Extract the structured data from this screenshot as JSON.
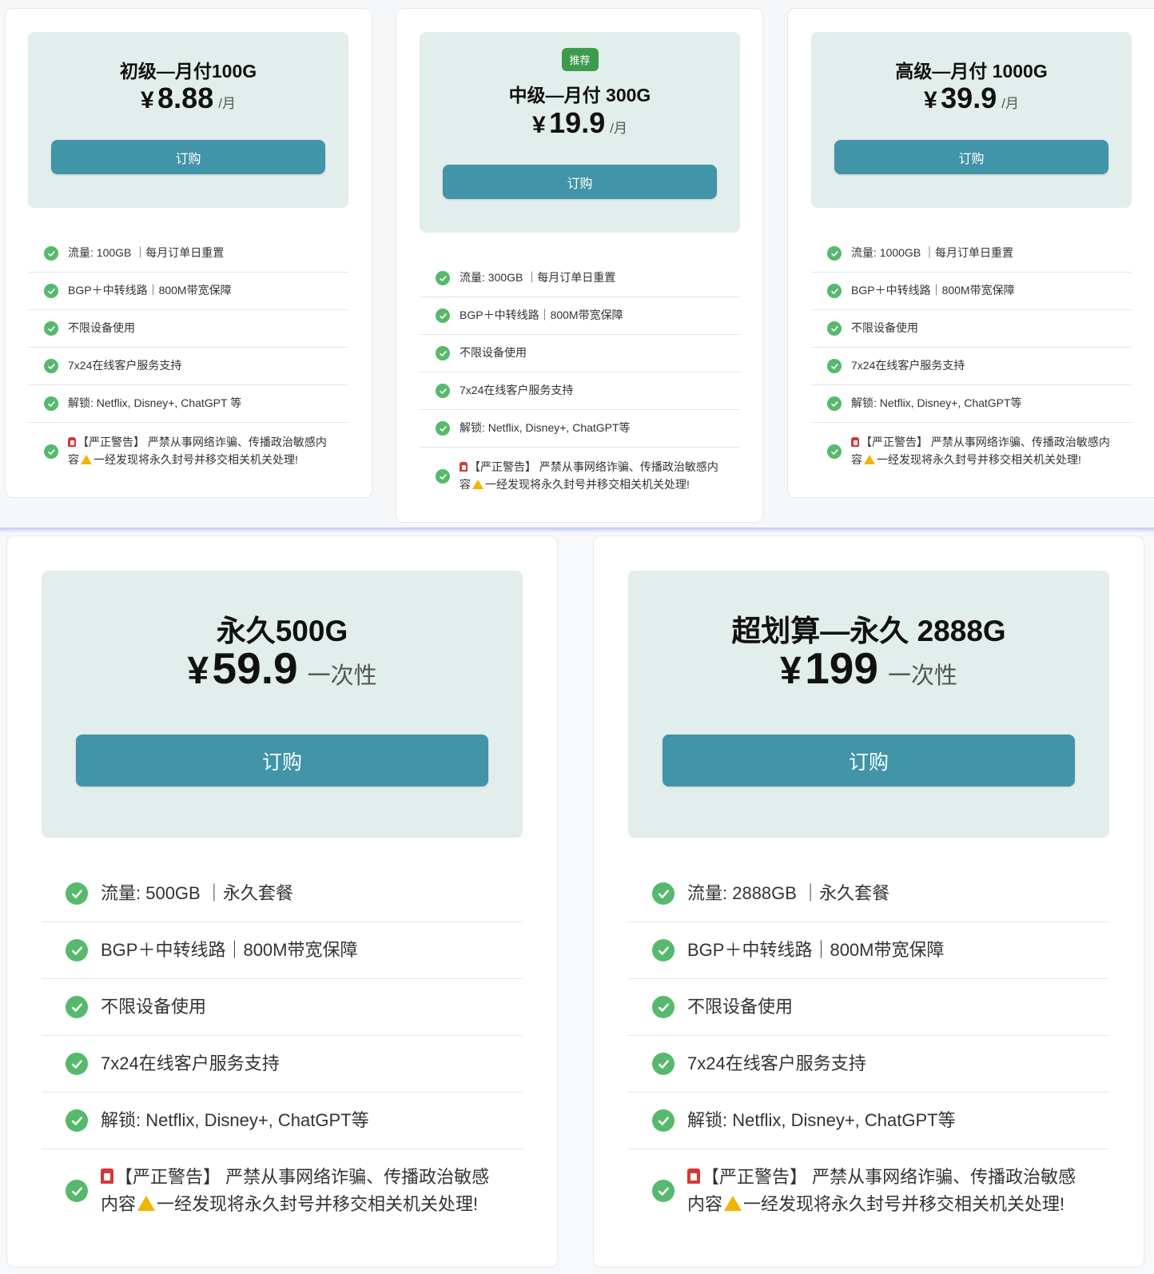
{
  "plans_monthly": [
    {
      "title": "初级—月付100G",
      "currency": "¥",
      "price": "8.88",
      "unit": "/月",
      "button": "订购",
      "features": [
        "流量: 100GB ｜每月订单日重置",
        "BGP＋中转线路｜800M带宽保障",
        "不限设备使用",
        "7x24在线客户服务支持",
        "解锁: Netflix, Disney+, ChatGPT 等"
      ],
      "warning": {
        "part1": "【严正警告】 严禁从事网络诈骗、传播政治敏感内容",
        "part2": "一经发现将永久封号并移交相关机关处理!"
      }
    },
    {
      "badge": "推荐",
      "title": "中级—月付 300G",
      "currency": "¥",
      "price": "19.9",
      "unit": "/月",
      "button": "订购",
      "features": [
        "流量: 300GB ｜每月订单日重置",
        "BGP＋中转线路｜800M带宽保障",
        "不限设备使用",
        "7x24在线客户服务支持",
        "解锁: Netflix, Disney+, ChatGPT等"
      ],
      "warning": {
        "part1": "【严正警告】 严禁从事网络诈骗、传播政治敏感内容",
        "part2": "一经发现将永久封号并移交相关机关处理!"
      }
    },
    {
      "title": "高级—月付 1000G",
      "currency": "¥",
      "price": "39.9",
      "unit": "/月",
      "button": "订购",
      "features": [
        "流量: 1000GB ｜每月订单日重置",
        "BGP＋中转线路｜800M带宽保障",
        "不限设备使用",
        "7x24在线客户服务支持",
        "解锁: Netflix, Disney+, ChatGPT等"
      ],
      "warning": {
        "part1": "【严正警告】 严禁从事网络诈骗、传播政治敏感内容",
        "part2": "一经发现将永久封号并移交相关机关处理!"
      }
    }
  ],
  "plans_lifetime": [
    {
      "title": "永久500G",
      "currency": "¥",
      "price": "59.9",
      "unit": "一次性",
      "button": "订购",
      "features": [
        "流量: 500GB ｜永久套餐",
        "BGP＋中转线路｜800M带宽保障",
        "不限设备使用",
        "7x24在线客户服务支持",
        "解锁: Netflix, Disney+, ChatGPT等"
      ],
      "warning": {
        "part1": "【严正警告】 严禁从事网络诈骗、传播政治敏感内容",
        "part2": "一经发现将永久封号并移交相关机关处理!"
      }
    },
    {
      "title": "超划算—永久 2888G",
      "currency": "¥",
      "price": "199",
      "unit": "一次性",
      "button": "订购",
      "features": [
        "流量: 2888GB ｜永久套餐",
        "BGP＋中转线路｜800M带宽保障",
        "不限设备使用",
        "7x24在线客户服务支持",
        "解锁: Netflix, Disney+, ChatGPT等"
      ],
      "warning": {
        "part1": "【严正警告】 严禁从事网络诈骗、传播政治敏感内容",
        "part2": "一经发现将永久封号并移交相关机关处理!"
      }
    }
  ],
  "icons": {
    "check": "check-circle-icon",
    "siren": "siren-emoji-icon",
    "warning": "warning-triangle-icon"
  },
  "colors": {
    "accent_button": "#4294a8",
    "hero_background": "#e1eeeb",
    "check_green": "#56b96c",
    "badge_green": "#3c9c4c"
  }
}
